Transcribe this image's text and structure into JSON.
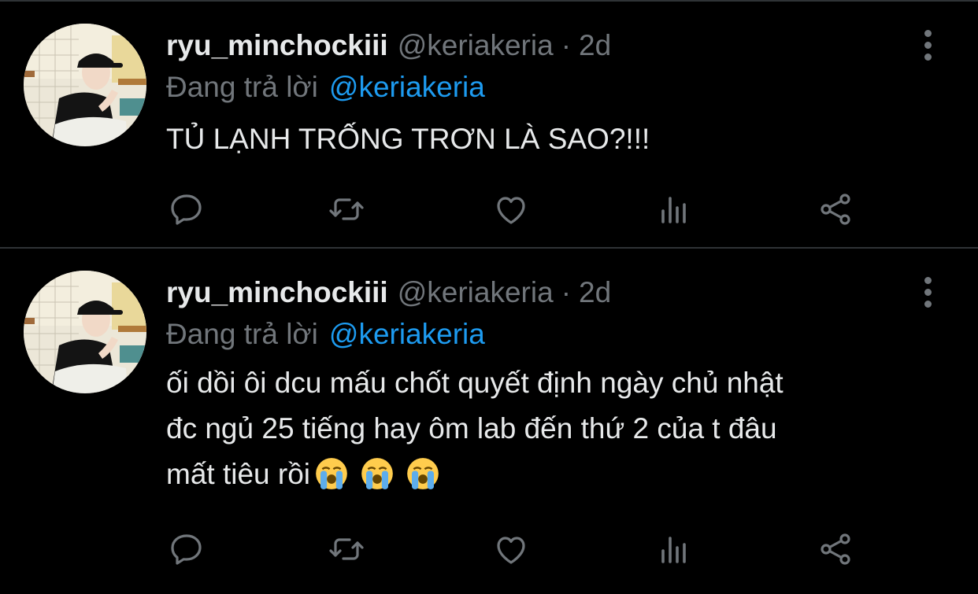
{
  "colors": {
    "background": "#000000",
    "divider": "#2f3336",
    "primary_text": "#e7e9ea",
    "secondary_text": "#71767b",
    "mention": "#1d9bf0"
  },
  "tweets": [
    {
      "display_name": "ryu_minchockiii",
      "handle": "@keriakeria",
      "separator": "·",
      "time": "2d",
      "reply_prefix": "Đang trả lời",
      "reply_to": "@keriakeria",
      "text": "TỦ LẠNH TRỐNG TRƠN LÀ SAO?!!!",
      "emojis": [],
      "actions": [
        "reply-icon",
        "retweet-icon",
        "like-icon",
        "views-icon",
        "share-icon"
      ]
    },
    {
      "display_name": "ryu_minchockiii",
      "handle": "@keriakeria",
      "separator": "·",
      "time": "2d",
      "reply_prefix": "Đang trả lời",
      "reply_to": "@keriakeria",
      "text": "ối dồi ôi dcu mấu chốt quyết định ngày chủ nhật\nđc ngủ 25 tiếng hay ôm lab đến thứ 2 của t đâu\nmất tiêu rồi",
      "emojis": [
        "loudly-crying-face",
        "loudly-crying-face",
        "loudly-crying-face"
      ],
      "actions": [
        "reply-icon",
        "retweet-icon",
        "like-icon",
        "views-icon",
        "share-icon"
      ]
    }
  ]
}
